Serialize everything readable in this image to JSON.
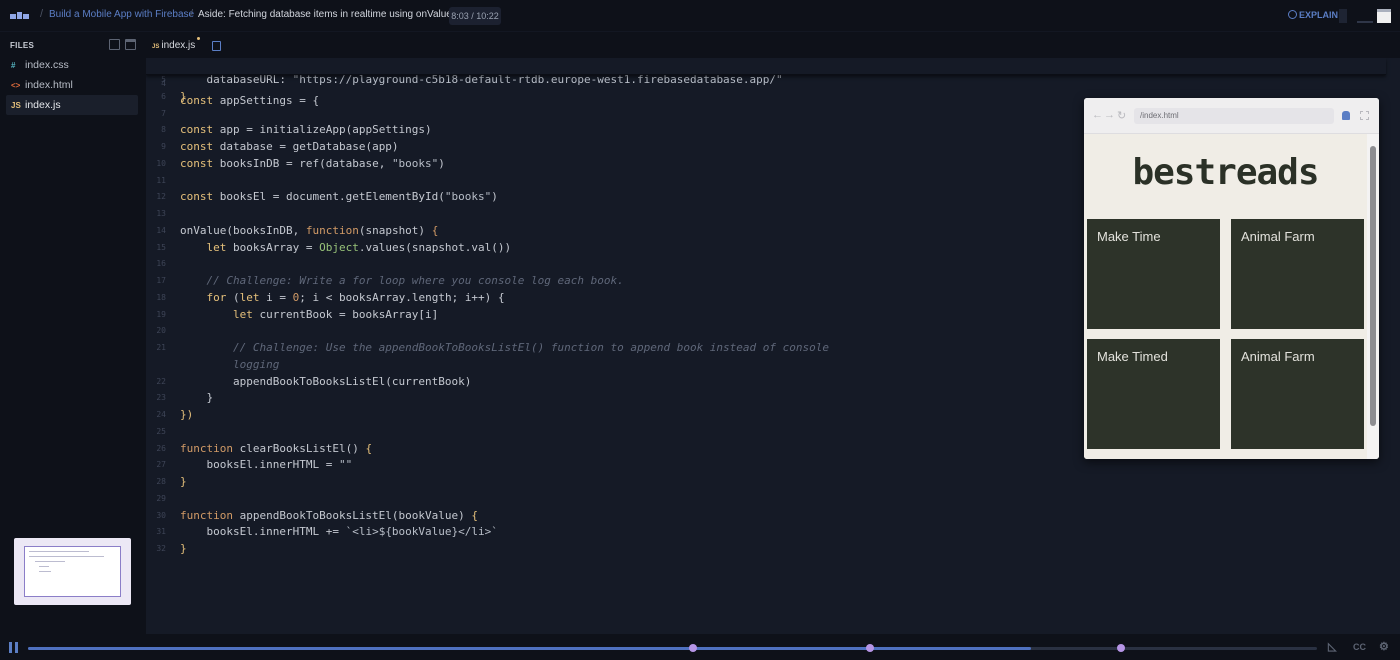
{
  "header": {
    "breadcrumb_course": "Build a Mobile App with Firebase",
    "breadcrumb_lesson": "Aside: Fetching database items in realtime using onValue",
    "timecode": "8:03 / 10:22",
    "explain_label": "EXPLAIN"
  },
  "files_panel": {
    "title": "FILES",
    "files": [
      {
        "glyph": "#",
        "name": "index.css",
        "glyph_color": "#56b6c2"
      },
      {
        "glyph": "<>",
        "name": "index.html",
        "glyph_color": "#e06c3c"
      },
      {
        "glyph": "JS",
        "name": "index.js",
        "glyph_color": "#e5c07b"
      }
    ]
  },
  "editor": {
    "tab_glyph": "JS",
    "tab_name": "index.js",
    "sticky": {
      "num": "4",
      "html": "<span class=\"kw\">const</span> appSettings = {"
    },
    "lines": [
      {
        "num": "5",
        "html": "    databaseURL: <span class=\"str\">\"https://playground-c5b18-default-rtdb.europe-west1.firebasedatabase.app/\"</span>"
      },
      {
        "num": "6",
        "html": "<span class=\"kw\">}</span>"
      },
      {
        "num": "7",
        "html": ""
      },
      {
        "num": "8",
        "html": "<span class=\"kw\">const</span> app = initializeApp(appSettings)"
      },
      {
        "num": "9",
        "html": "<span class=\"kw\">const</span> database = getDatabase(app)"
      },
      {
        "num": "10",
        "html": "<span class=\"kw\">const</span> booksInDB = ref(database, <span class=\"str\">\"books\"</span>)"
      },
      {
        "num": "11",
        "html": ""
      },
      {
        "num": "12",
        "html": "<span class=\"kw\">const</span> booksEl = document.getElementById(<span class=\"str\">\"books\"</span>)"
      },
      {
        "num": "13",
        "html": ""
      },
      {
        "num": "14",
        "html": "onValue(booksInDB, <span class=\"kw2\">function</span>(snapshot) <span class=\"kw2\">{</span>"
      },
      {
        "num": "15",
        "html": "    <span class=\"kw\">let</span> booksArray = <span class=\"obj\">Object</span>.values(snapshot.val())"
      },
      {
        "num": "16",
        "html": ""
      },
      {
        "num": "17",
        "html": "    <span class=\"cmt\">// Challenge: Write a for loop where you console log each book.</span>"
      },
      {
        "num": "18",
        "html": "    <span class=\"kw\">for</span> (<span class=\"kw\">let</span> i = <span class=\"kw2\">0</span>; i &lt; booksArray.length; i++) <span class=\"fn\">{</span>"
      },
      {
        "num": "19",
        "html": "        <span class=\"kw\">let</span> currentBook = booksArray[i]"
      },
      {
        "num": "20",
        "html": ""
      },
      {
        "num": "21",
        "html": "        <span class=\"cmt\">// Challenge: Use the appendBookToBooksListEl() function to append book instead of console</span>"
      },
      {
        "num": "",
        "html": "        <span class=\"cmt\">logging</span>"
      },
      {
        "num": "22",
        "html": "        appendBookToBooksListEl(currentBook)"
      },
      {
        "num": "23",
        "html": "    <span class=\"fn\">}</span>"
      },
      {
        "num": "24",
        "html": "<span class=\"kw\">})</span>"
      },
      {
        "num": "25",
        "html": ""
      },
      {
        "num": "26",
        "html": "<span class=\"kw2\">function</span> clearBooksListEl() <span class=\"kw\">{</span>"
      },
      {
        "num": "27",
        "html": "    booksEl.innerHTML = <span class=\"str\">\"\"</span>"
      },
      {
        "num": "28",
        "html": "<span class=\"kw\">}</span>"
      },
      {
        "num": "29",
        "html": ""
      },
      {
        "num": "30",
        "html": "<span class=\"kw2\">function</span> appendBookToBooksListEl(bookValue) <span class=\"kw\">{</span>"
      },
      {
        "num": "31",
        "html": "    booksEl.innerHTML += <span class=\"str\">`&lt;li&gt;${bookValue}&lt;/li&gt;`</span>"
      },
      {
        "num": "32",
        "html": "<span class=\"kw\">}</span>"
      }
    ]
  },
  "preview": {
    "url": "/index.html",
    "heading": "bestreads",
    "books": [
      "Make Time",
      "Animal Farm",
      "Make Timed",
      "Animal Farm"
    ]
  },
  "player": {
    "progress_fraction": 0.778,
    "markers_fraction": [
      0.516,
      0.653,
      0.848
    ]
  }
}
